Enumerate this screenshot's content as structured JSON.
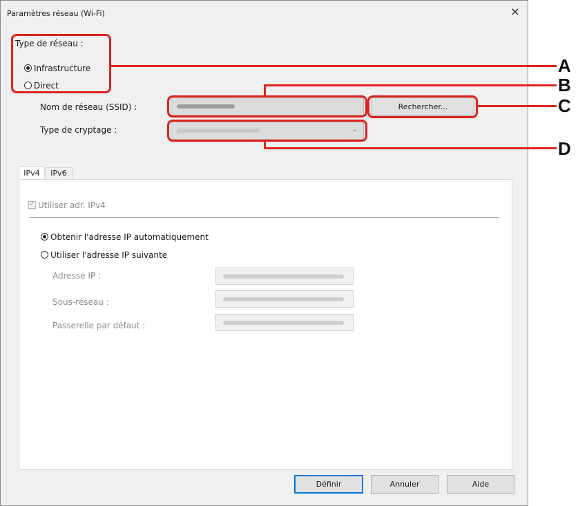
{
  "window": {
    "title": "Paramètres réseau (Wi-Fi)",
    "close_glyph": "×"
  },
  "network_type": {
    "label": "Type de réseau :",
    "options": [
      {
        "label": "Infrastructure",
        "selected": true
      },
      {
        "label": "Direct",
        "selected": false
      }
    ]
  },
  "ssid": {
    "label": "Nom de réseau (SSID) :",
    "search_button": "Rechercher..."
  },
  "encryption": {
    "label": "Type de cryptage :",
    "arrow": "⌄"
  },
  "tabs": [
    {
      "label": "IPv4",
      "active": true
    },
    {
      "label": "IPv6",
      "active": false
    }
  ],
  "ipv4": {
    "use_checkbox": "Utiliser adr. IPv4",
    "auto_option": "Obtenir l'adresse IP automatiquement",
    "manual_option": "Utiliser l'adresse IP suivante",
    "ip_label": "Adresse IP :",
    "subnet_label": "Sous-réseau :",
    "gateway_label": "Passerelle par défaut :"
  },
  "buttons": {
    "set": "Définir",
    "cancel": "Annuler",
    "help": "Aide"
  },
  "callouts": [
    "A",
    "B",
    "C",
    "D"
  ],
  "colors": {
    "highlight": "#e0211e",
    "default_button_border": "#0078d7"
  }
}
